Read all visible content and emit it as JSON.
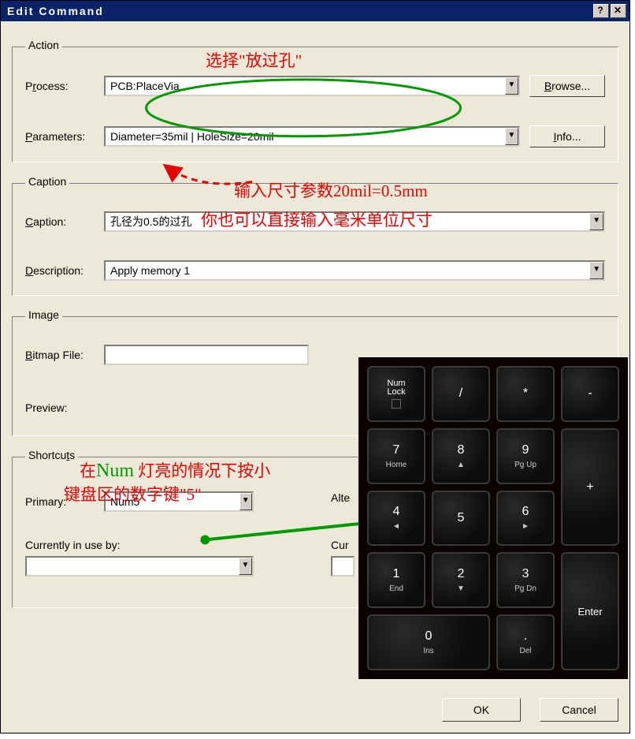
{
  "window": {
    "title": "Edit Command",
    "help_btn": "?",
    "close_btn": "✕"
  },
  "action": {
    "legend": "Action",
    "process_label": "Process:",
    "process_value": "PCB:PlaceVia",
    "browse_label": "Browse...",
    "parameters_label": "Parameters:",
    "parameters_value": "Diameter=35mil | HoleSize=20mil",
    "info_label": "Info..."
  },
  "caption": {
    "legend": "Caption",
    "caption_label": "Caption:",
    "caption_value": "孔径为0.5的过孔",
    "description_label": "Description:",
    "description_value": "Apply memory 1"
  },
  "image": {
    "legend": "Image",
    "bitmap_label": "Bitmap File:",
    "bitmap_value": "",
    "preview_label": "Preview:"
  },
  "shortcuts": {
    "legend": "Shortcuts",
    "primary_label": "Primary:",
    "primary_value": "Num5",
    "alternative_label": "Alte",
    "currently_label": "Currently in use by:",
    "cur_label": "Cur"
  },
  "footer": {
    "ok_label": "OK",
    "cancel_label": "Cancel"
  },
  "annotations": {
    "a1": "选择\"放过孔\"",
    "a2": "输入尺寸参数20mil=0.5mm",
    "a3": "你也可以直接输入毫米单位尺寸",
    "a4a": "在",
    "a4b": "Num",
    "a4c": "灯亮的情况下按小",
    "a5": "键盘区的数字键\"5\""
  },
  "keyboard": {
    "keys": [
      {
        "main": "Num\nLock",
        "sub": "",
        "cls": "numlock"
      },
      {
        "main": "/",
        "sub": ""
      },
      {
        "main": "*",
        "sub": ""
      },
      {
        "main": "-",
        "sub": ""
      },
      {
        "main": "7",
        "sub": "Home"
      },
      {
        "main": "8",
        "sub": "▲"
      },
      {
        "main": "9",
        "sub": "Pg Up"
      },
      {
        "main": "+",
        "sub": "",
        "cls": "tall"
      },
      {
        "main": "4",
        "sub": "◄"
      },
      {
        "main": "5",
        "sub": ""
      },
      {
        "main": "6",
        "sub": "►"
      },
      {
        "main": "1",
        "sub": "End"
      },
      {
        "main": "2",
        "sub": "▼"
      },
      {
        "main": "3",
        "sub": "Pg Dn"
      },
      {
        "main": "Enter",
        "sub": "",
        "cls": "tall"
      },
      {
        "main": "0",
        "sub": "Ins",
        "cls": "wide"
      },
      {
        "main": ".",
        "sub": "Del"
      }
    ]
  }
}
